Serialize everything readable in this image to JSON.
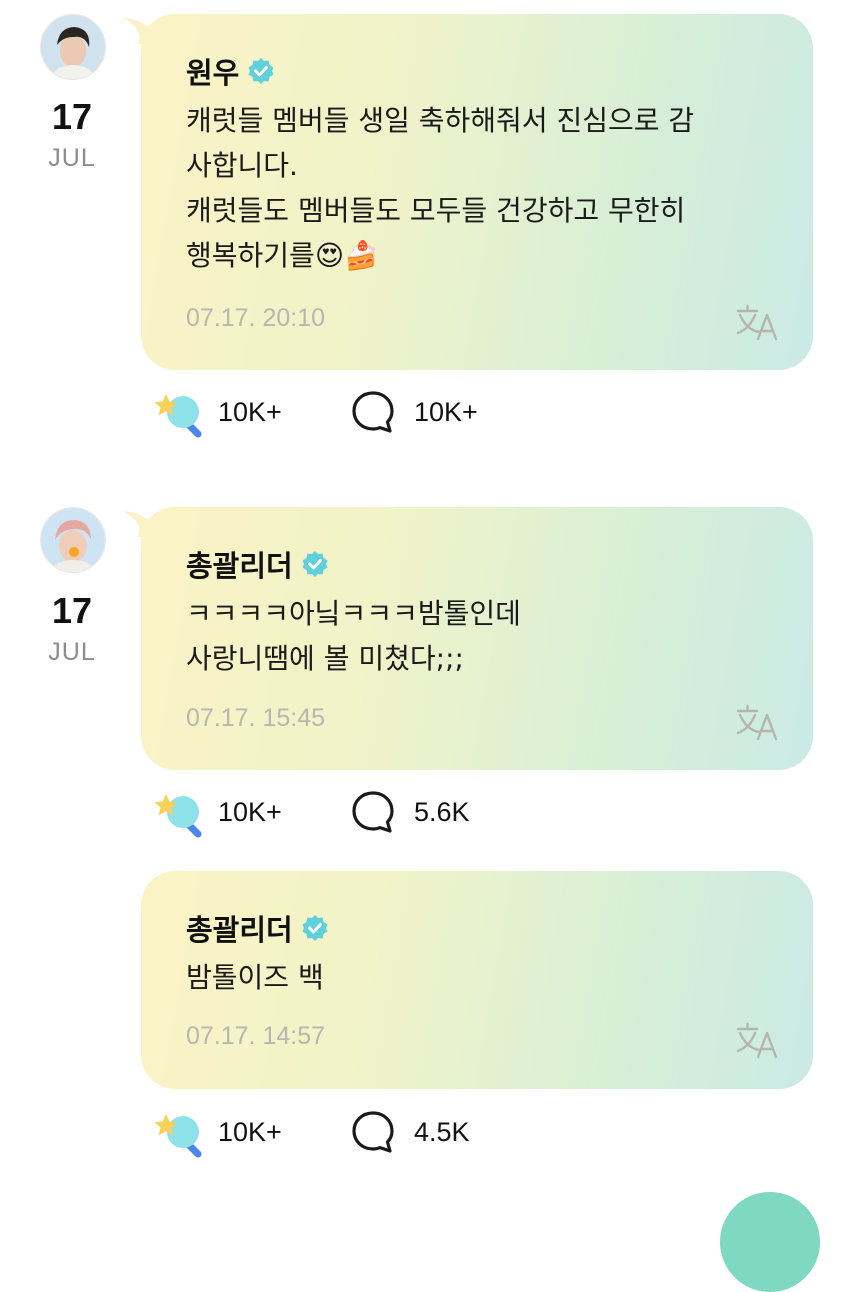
{
  "posts": [
    {
      "date_day": "17",
      "date_month": "JUL",
      "author": "원우",
      "text": "캐럿들 멤버들 생일 축하해줘서 진심으로 감\n사합니다.\n캐럿들도 멤버들도 모두들 건강하고 무한히\n행복하기를",
      "emojis": [
        "😍",
        "🍰"
      ],
      "time": "07.17. 20:10",
      "likes": "10K+",
      "comments": "10K+"
    },
    {
      "date_day": "17",
      "date_month": "JUL",
      "author": "총괄리더",
      "text": "ㅋㅋㅋㅋ아닠ㅋㅋㅋ밤톨인데\n사랑니땜에 볼 미쳤다;;;",
      "time": "07.17. 15:45",
      "likes": "10K+",
      "comments": "5.6K"
    },
    {
      "author": "총괄리더",
      "text": "밤톨이즈 백",
      "time": "07.17. 14:57",
      "likes": "10K+",
      "comments": "4.5K"
    }
  ],
  "icons": {
    "verified": "verified-badge-icon",
    "translate": "translate-icon",
    "like": "star-lightstick-icon",
    "comment": "speech-bubble-icon"
  },
  "colors": {
    "verified": "#5fd0dc",
    "timestamp": "#b6b7b0",
    "month": "#8d8d8d"
  }
}
